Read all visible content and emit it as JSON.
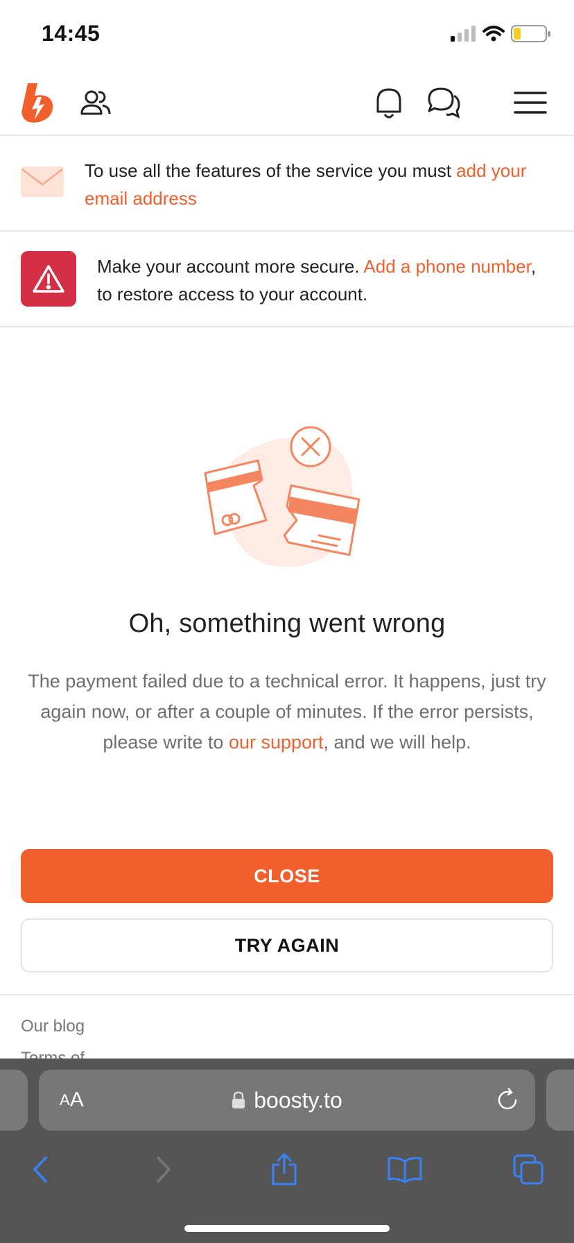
{
  "status_bar": {
    "time": "14:45"
  },
  "header": {
    "logo_icon": "boosty-logo",
    "icons": [
      "users-icon",
      "bell-icon",
      "chat-icon",
      "hamburger-menu-icon"
    ],
    "brand_color": "#f15f2c"
  },
  "email_notice": {
    "text": "To use all the features of the service you must ",
    "link": "add your email address"
  },
  "phone_notice": {
    "text_before": "Make your account more secure. ",
    "link": "Add a phone number",
    "text_after": ",  to restore access to your account."
  },
  "error": {
    "title": "Oh, something went wrong",
    "desc_before": "The payment failed due to a technical error. It happens, just try again now, or after a couple of minutes. If the error persists, please write to ",
    "desc_link": "our support",
    "desc_after": ", and we will help."
  },
  "actions": {
    "close_label": "CLOSE",
    "try_again_label": "TRY AGAIN"
  },
  "footer": {
    "links": [
      "Our blog",
      "Terms of"
    ]
  },
  "browser": {
    "aa_small": "A",
    "aa_large": "A",
    "url": "boosty.to",
    "toolbar": [
      "back-icon",
      "forward-icon",
      "share-icon",
      "bookmarks-icon",
      "tabs-icon"
    ],
    "accent_color": "#3a82f7"
  }
}
